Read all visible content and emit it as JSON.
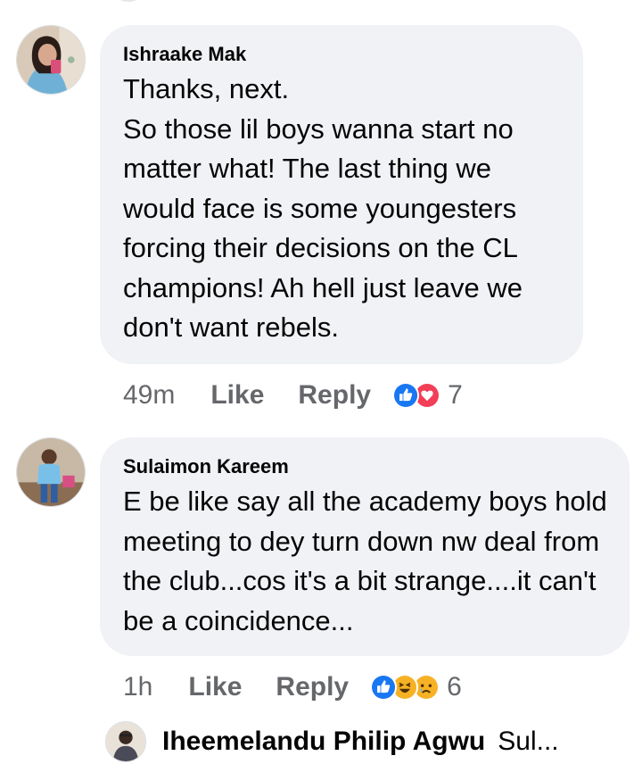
{
  "comments": [
    {
      "author": "Ishraake Mak",
      "text": "Thanks, next.\nSo those lil boys wanna start no matter what! The last thing we would face is some youngesters forcing their decisions on the CL champions! Ah hell just leave we don't want rebels.",
      "time": "49m",
      "like_label": "Like",
      "reply_label": "Reply",
      "reaction_icons": [
        "like-icon",
        "love-icon"
      ],
      "reaction_count": "7"
    },
    {
      "author": "Sulaimon Kareem",
      "text": "E be like say all the academy boys hold meeting to dey turn down nw deal from the club...cos it's a bit strange....it can't be a coincidence...",
      "time": "1h",
      "like_label": "Like",
      "reply_label": "Reply",
      "reaction_icons": [
        "like-icon",
        "haha-icon",
        "sad-icon"
      ],
      "reaction_count": "6"
    }
  ],
  "reply_preview": {
    "author": "Iheemelandu Philip Agwu",
    "snippet": "Sul..."
  },
  "colors": {
    "bubble": "#f0f2f5",
    "secondary_text": "#65676b",
    "like_blue": "#1877f2",
    "love_red": "#f33e58",
    "emoji_yellow": "#f7b125"
  }
}
